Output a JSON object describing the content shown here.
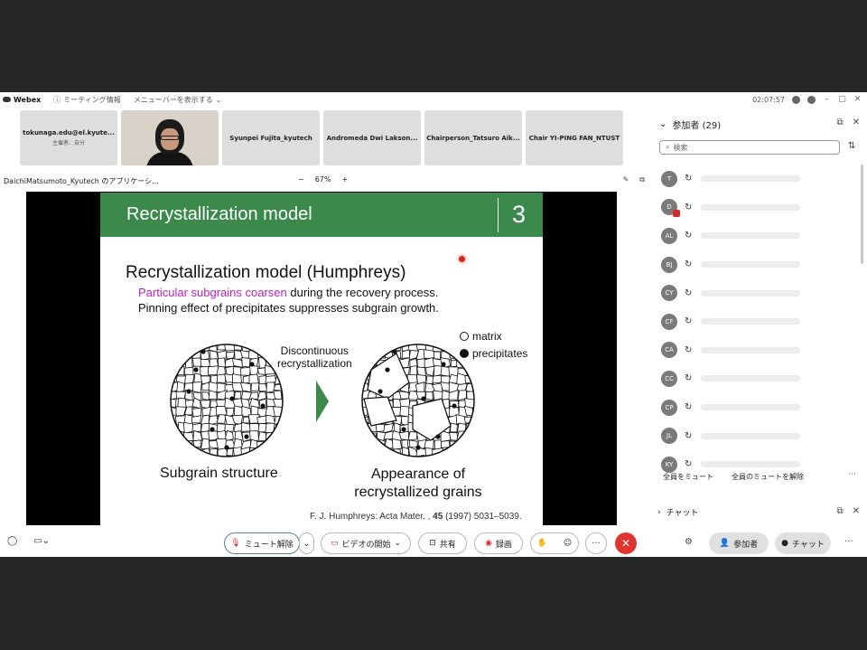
{
  "titlebar": {
    "app": "Webex",
    "meeting_info": "ミーティング情報",
    "menu_bar": "メニューバーを表示する",
    "time": "02:07:57"
  },
  "tiles": [
    {
      "name": "tokunaga.edu@el.kyute...",
      "sub": "主催者、自分"
    },
    {
      "name": "",
      "sub": ""
    },
    {
      "name": "Syunpei Fujita_kyutech",
      "sub": ""
    },
    {
      "name": "Andromeda Dwi Lakson...",
      "sub": ""
    },
    {
      "name": "Chairperson_Tatsuro Aik...",
      "sub": ""
    },
    {
      "name": "Chair YI-PING FAN_NTUST",
      "sub": ""
    }
  ],
  "share": {
    "app_name": "DaichiMatsumoto_Kyutech のアプリケーシ...",
    "zoom": "67%",
    "zoom_out": "−",
    "zoom_in": "+"
  },
  "slide": {
    "title": "Recrystallization model",
    "number": "3",
    "heading": "Recrystallization model (Humphreys)",
    "line1_highlight": "Particular subgrains coarsen",
    "line1_rest": " during the recovery process.",
    "line2": "Pinning effect of precipitates suppresses subgrain growth.",
    "legend_matrix": "matrix",
    "legend_precipitates": "precipitates",
    "arrow_label_1": "Discontinuous",
    "arrow_label_2": "recrystallization",
    "label_left": "Subgrain structure",
    "label_right_1": "Appearance of",
    "label_right_2": "recrystallized grains",
    "reference_prefix": "F. J. Humphreys: Acta Mater. , ",
    "reference_volume": "45",
    "reference_suffix": " (1997) 5031–5039.",
    "accent_color": "#3b8a4c",
    "highlight_color": "#c020c0"
  },
  "panel": {
    "title": "参加者 (29)",
    "search_placeholder": "検索",
    "participants": [
      {
        "initials": "T",
        "badge": false
      },
      {
        "initials": "D",
        "badge": true
      },
      {
        "initials": "AL",
        "badge": false
      },
      {
        "initials": "BJ",
        "badge": false
      },
      {
        "initials": "CY",
        "badge": false
      },
      {
        "initials": "CF",
        "badge": false
      },
      {
        "initials": "CA",
        "badge": false
      },
      {
        "initials": "CC",
        "badge": false
      },
      {
        "initials": "CP",
        "badge": false
      },
      {
        "initials": "JL",
        "badge": false
      },
      {
        "initials": "KY",
        "badge": false
      }
    ],
    "mute_all": "全員をミュート",
    "unmute_all": "全員のミュートを解除",
    "chat": "チャット"
  },
  "bottombar": {
    "unmute": "ミュート解除",
    "start_video": "ビデオの開始",
    "share": "共有",
    "record": "録画",
    "participants": "参加者",
    "chat": "チャット",
    "more": "···"
  }
}
